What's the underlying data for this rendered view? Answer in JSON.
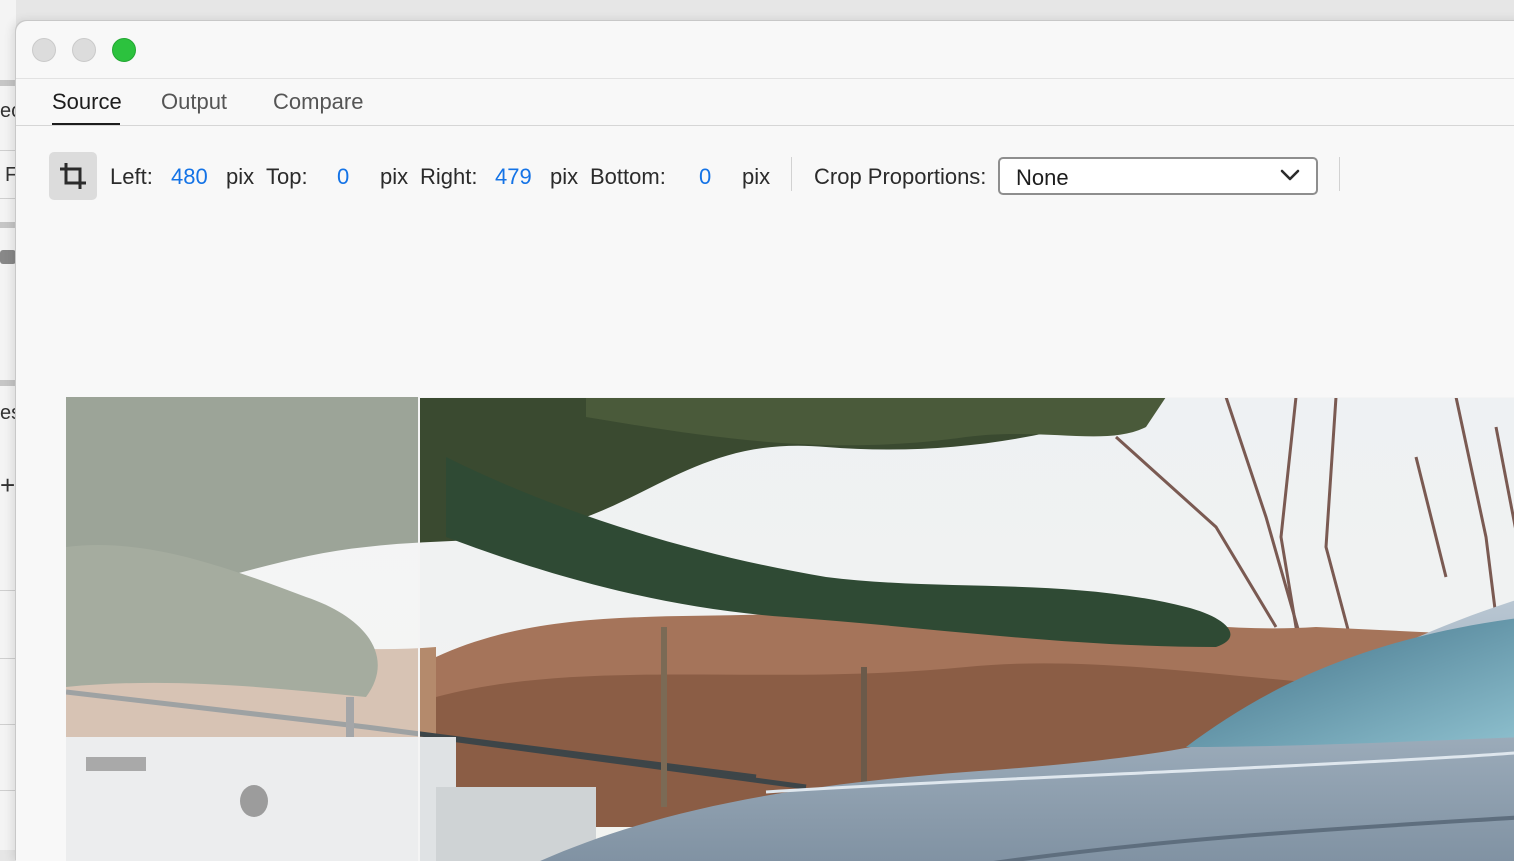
{
  "background_app": {
    "fragments": [
      "ec",
      "F",
      "es",
      "+"
    ]
  },
  "tabs": [
    {
      "label": "Source",
      "active": true
    },
    {
      "label": "Output",
      "active": false
    },
    {
      "label": "Compare",
      "active": false
    }
  ],
  "crop": {
    "left_label": "Left:",
    "left_value": "480",
    "top_label": "Top:",
    "top_value": "0",
    "right_label": "Right:",
    "right_value": "479",
    "bottom_label": "Bottom:",
    "bottom_value": "0",
    "unit": "pix",
    "proportions_label": "Crop Proportions:",
    "proportions_value": "None"
  },
  "colors": {
    "accent": "#1473e6",
    "zoom_button": "#2cc23e"
  },
  "icons": {
    "crop": "crop-icon",
    "dropdown": "chevron-down-icon"
  }
}
